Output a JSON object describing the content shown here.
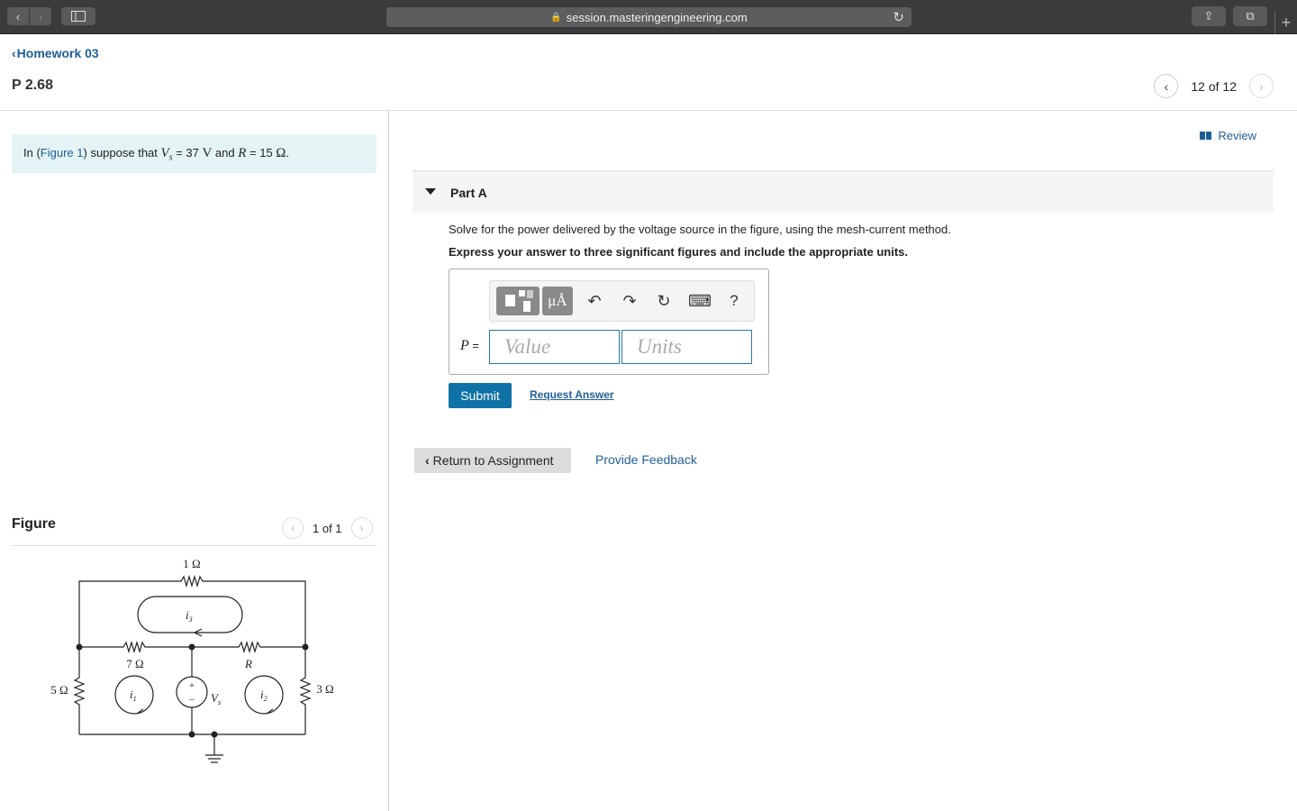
{
  "browser": {
    "url": "session.masteringengineering.com",
    "back_glyph": "‹",
    "forward_glyph": "›",
    "lock_glyph": "🔒",
    "reload_glyph": "↻",
    "share_glyph": "⇪",
    "tabs_glyph": "⧉",
    "newtab_glyph": "+"
  },
  "header": {
    "breadcrumb": "Homework 03",
    "breadcrumb_chevron": "‹",
    "title": "P 2.68",
    "pager": {
      "prev": "‹",
      "count": "12 of 12",
      "next": "›"
    }
  },
  "problem": {
    "prefix": "In (",
    "figure_link": "Figure 1",
    "mid": ") suppose that ",
    "vs_symbol": "V",
    "vs_sub": "s",
    "vs_eq": " = 37 ",
    "vs_unit": "V",
    "and": " and ",
    "r_symbol": "R",
    "r_eq": " = 15 ",
    "r_unit": "Ω",
    "end": "."
  },
  "figure": {
    "title": "Figure",
    "pager": {
      "prev": "‹",
      "count": "1 of 1",
      "next": "›"
    },
    "labels": {
      "r_top": "1 Ω",
      "r_left_mid": "7 Ω",
      "r_right_mid": "R",
      "r_left": "5 Ω",
      "r_right": "3 Ω",
      "source": "V",
      "source_sub": "s",
      "plus": "+",
      "minus": "−",
      "mesh1": "i",
      "mesh1_sub": "1",
      "mesh2": "i",
      "mesh2_sub": "2",
      "mesh3": "i",
      "mesh3_sub": "3"
    }
  },
  "review": {
    "label": "Review"
  },
  "part": {
    "label": "Part A",
    "question": "Solve for the power delivered by the voltage source in the figure, using the mesh-current method.",
    "instructions": "Express your answer to three significant figures and include the appropriate units.",
    "toolbar": {
      "template_icon": "templates-icon",
      "units_label": "μÅ",
      "undo": "↶",
      "redo": "↷",
      "reset": "↻",
      "keyboard": "⌨",
      "help": "?"
    },
    "answer_var": "P",
    "answer_eq": " =",
    "value_placeholder": "Value",
    "units_placeholder": "Units",
    "submit": "Submit",
    "request_answer": "Request Answer"
  },
  "footer": {
    "return": "Return to Assignment",
    "return_chevron": "‹",
    "feedback": "Provide Feedback"
  }
}
